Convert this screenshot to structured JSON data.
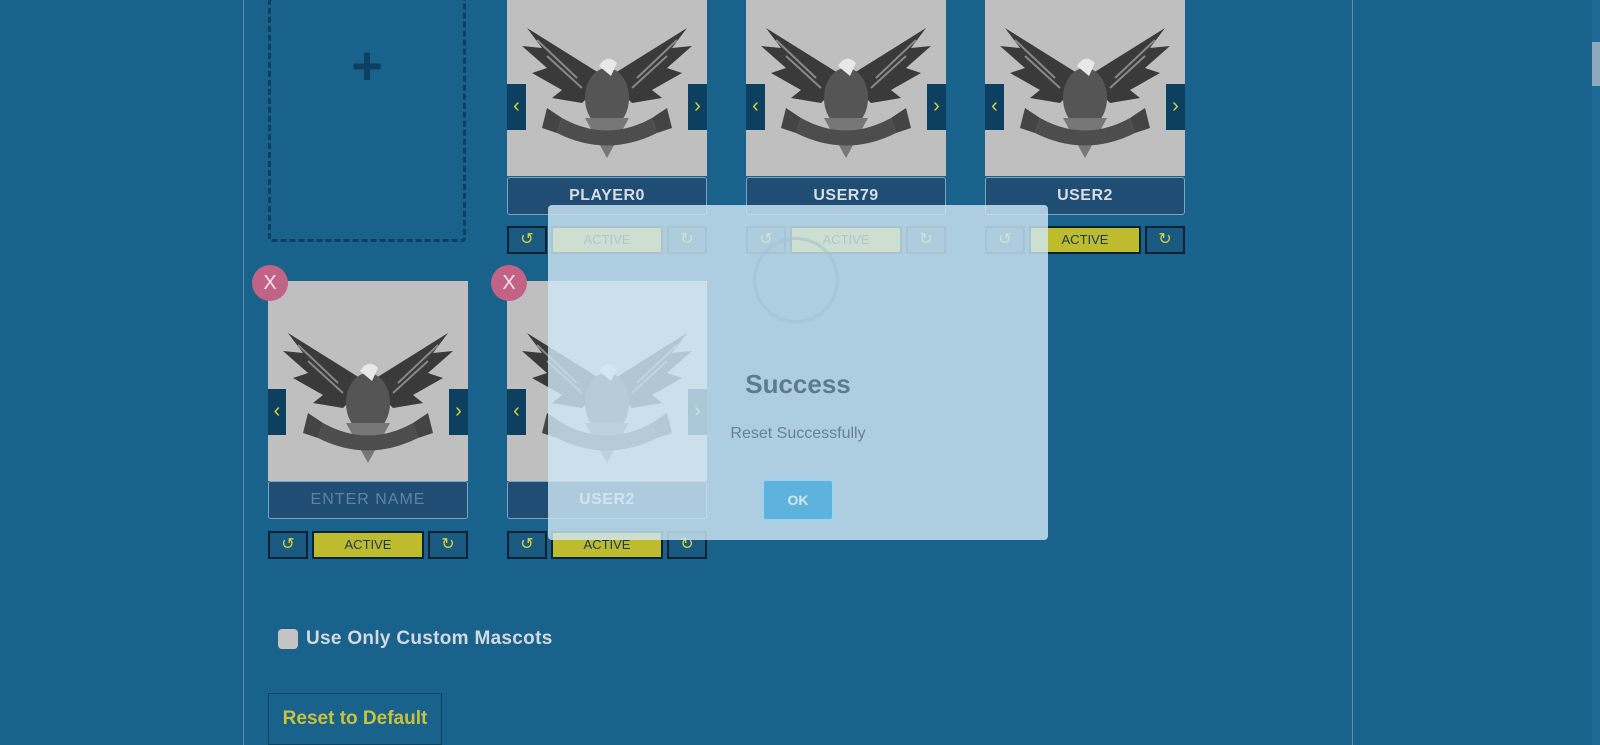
{
  "add_card": {
    "icon": "plus-icon"
  },
  "cards": [
    {
      "name": "PLAYER0",
      "status": "ACTIVE"
    },
    {
      "name": "USER79",
      "status": "ACTIVE"
    },
    {
      "name": "USER2",
      "status": "ACTIVE"
    },
    {
      "name": "",
      "placeholder": "ENTER NAME",
      "status": "ACTIVE",
      "close": "X"
    },
    {
      "name": "USER2",
      "status": "ACTIVE",
      "close": "X"
    }
  ],
  "icons": {
    "prev": "‹",
    "next": "›",
    "reset": "↺",
    "redo": "↻"
  },
  "options": {
    "custom_mascots_label": "Use Only Custom Mascots",
    "custom_mascots_checked": false
  },
  "reset_default_label": "Reset to Default",
  "modal": {
    "title": "Success",
    "message": "Reset Successfully",
    "ok_label": "OK"
  },
  "colors": {
    "background": "#18628b",
    "accent": "#d6d23b",
    "close": "#c26284"
  }
}
